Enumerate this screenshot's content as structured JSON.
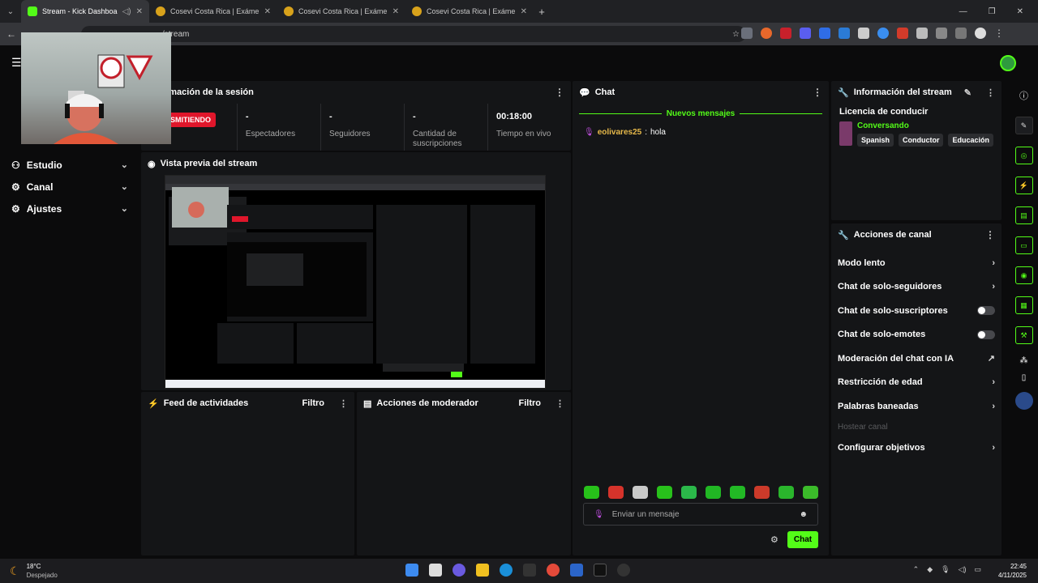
{
  "browser": {
    "tabs": [
      {
        "title": "Stream - Kick Dashboard",
        "active": true
      },
      {
        "title": "Cosevi Costa Rica | Exámenes Te",
        "active": false
      },
      {
        "title": "Cosevi Costa Rica | Exámenes Te",
        "active": false
      },
      {
        "title": "Cosevi Costa Rica | Exámenes Te",
        "active": false
      }
    ],
    "url_tail": "/stream",
    "new_tab": "+"
  },
  "nav": {
    "items": [
      {
        "label": "Estudio"
      },
      {
        "label": "Canal"
      },
      {
        "label": "Ajustes"
      }
    ]
  },
  "session": {
    "title": "rmación de la sesión",
    "live_badge": "SMITIENDO",
    "stats": [
      {
        "value": "-",
        "label": "Espectadores"
      },
      {
        "value": "-",
        "label": "Seguidores"
      },
      {
        "value": "-",
        "label": "Cantidad de suscripciones"
      },
      {
        "value": "00:18:00",
        "label": "Tiempo en vivo"
      }
    ]
  },
  "preview": {
    "title": "Vista previa del stream"
  },
  "activity": {
    "title": "Feed de actividades",
    "filter": "Filtro"
  },
  "moderator": {
    "title": "Acciones de moderador",
    "filter": "Filtro"
  },
  "chat": {
    "title": "Chat",
    "new_messages": "Nuevos mensajes",
    "messages": [
      {
        "user": "eolivares25",
        "text": "hola"
      }
    ],
    "input_placeholder": "Enviar un mensaje",
    "send_label": "Chat",
    "emote_colors": [
      "#27c11a",
      "#d6332b",
      "#c9c9c9",
      "#28c11b",
      "#2bb84a",
      "#21b724",
      "#22b925",
      "#cc3a2a",
      "#2ab52c",
      "#3bbb2a"
    ]
  },
  "stream_info": {
    "title": "Información del stream",
    "stream_title": "Licencia de conducir",
    "category": "Conversando",
    "tags": [
      "Spanish",
      "Conductor",
      "Educación"
    ]
  },
  "channel_actions": {
    "title": "Acciones de canal",
    "items": [
      {
        "label": "Modo lento",
        "end": "chevron"
      },
      {
        "label": "Chat de solo-seguidores",
        "end": "chevron"
      },
      {
        "label": "Chat de solo-suscriptores",
        "end": "toggle"
      },
      {
        "label": "Chat de solo-emotes",
        "end": "toggle"
      },
      {
        "label": "Moderación del chat con IA",
        "end": "external"
      },
      {
        "label": "Restricción de edad",
        "end": "chevron"
      },
      {
        "label": "Palabras baneadas",
        "end": "chevron"
      },
      {
        "label": "Hostear canal",
        "end": "none",
        "disabled": true
      },
      {
        "label": "Configurar objetivos",
        "end": "chevron"
      }
    ]
  },
  "taskbar": {
    "weather_temp": "18°C",
    "weather_desc": "Despejado",
    "time": "22:45",
    "date": "4/11/2025"
  },
  "colors": {
    "accent": "#53fc18",
    "live": "#e0162b",
    "username": "#e7b94a"
  }
}
